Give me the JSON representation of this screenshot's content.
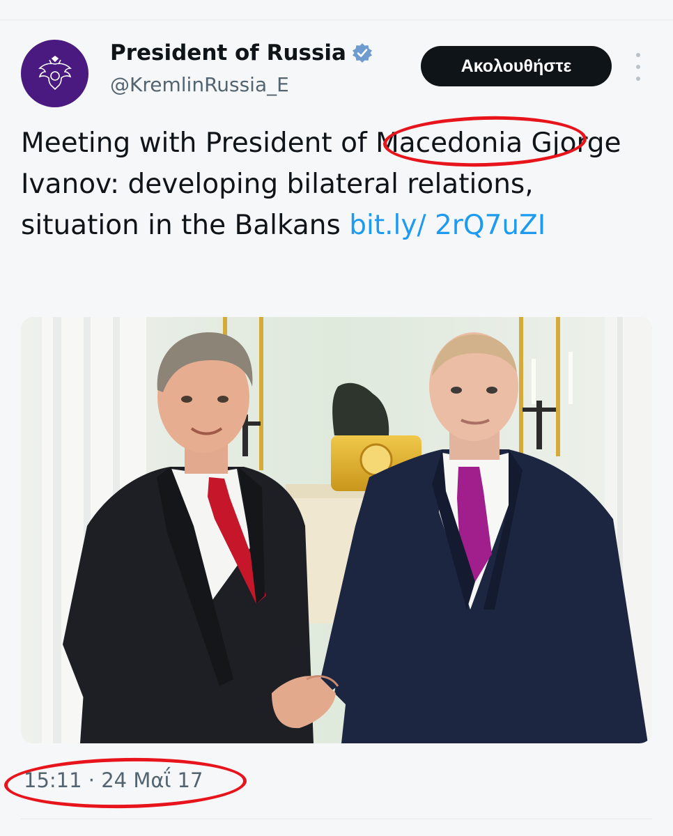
{
  "tweet": {
    "display_name": "President of Russia",
    "handle": "@KremlinRussia_E",
    "follow_label": "Ακολουθήστε",
    "text_before_link": "Meeting with President of Macedonia Gjorge Ivanov: developing bilateral relations, situation in the Balkans ",
    "link_text": "bit.ly/ 2rQ7uZI",
    "timestamp": "15:11 · 24 Μαΐ 17"
  },
  "icons": {
    "avatar": "russian-coat-of-arms-icon",
    "verified": "verified-badge-icon",
    "more": "more-vertical-icon"
  },
  "colors": {
    "accent": "#1d9bf0",
    "follow_bg": "#0f1419",
    "avatar_bg": "#4a1a80",
    "highlight": "#e8141b",
    "verified": "#6e9ccf"
  }
}
